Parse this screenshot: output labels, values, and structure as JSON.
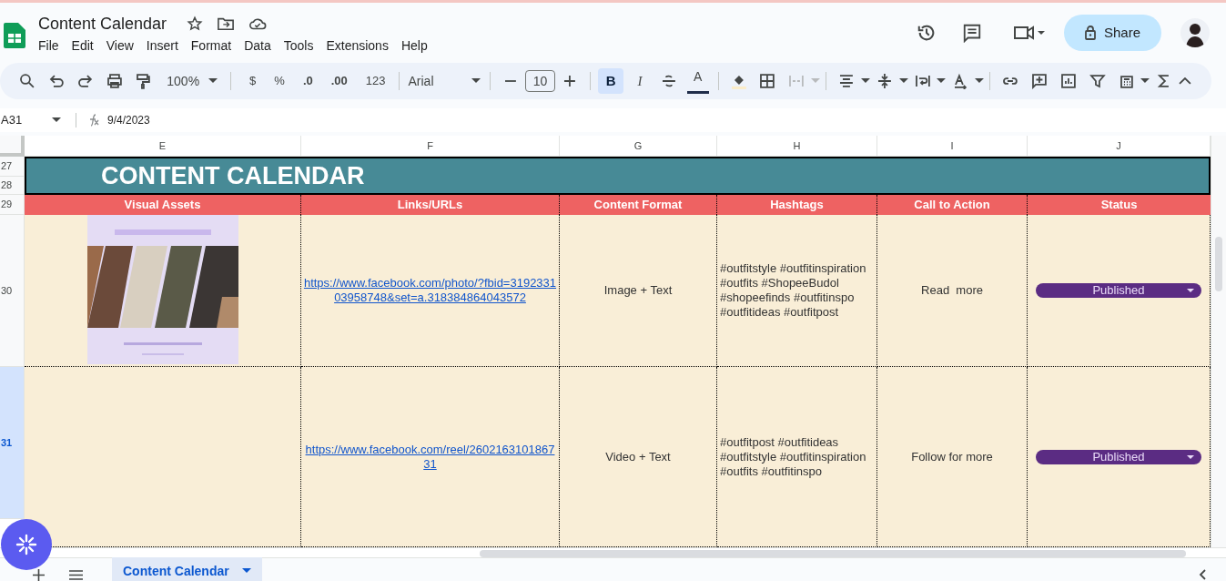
{
  "app": {
    "title": "Content Calendar",
    "menu": [
      "File",
      "Edit",
      "View",
      "Insert",
      "Format",
      "Data",
      "Tools",
      "Extensions",
      "Help"
    ]
  },
  "toolbar": {
    "zoom": "100%",
    "currency": "$",
    "percent": "%",
    "decrease_decimal": ".0",
    "increase_decimal": ".00",
    "number_format": "123",
    "font": "Arial",
    "font_size": "10",
    "text_styles": [
      {
        "label": "B",
        "selected": true
      },
      {
        "label": "I",
        "selected": false
      }
    ],
    "text_color": "A"
  },
  "share_button": "Share",
  "formula_bar": {
    "cell": "A31",
    "value": "9/4/2023"
  },
  "sheet": {
    "columns": [
      "E",
      "F",
      "G",
      "H",
      "I",
      "J"
    ],
    "title_rows": [
      "27",
      "28"
    ],
    "title": "CONTENT CALENDAR",
    "header_row_number": "29",
    "headers": [
      "Visual Assets",
      "Links/URLs",
      "Content Format",
      "Hashtags",
      "Call to Action",
      "Status"
    ],
    "rows": [
      {
        "number": "30",
        "selected": false,
        "link": "https://www.facebook.com/photo/?fbid=319233103958748&set=a.318384864043572",
        "format": "Image + Text",
        "hashtags": "#outfitstyle #outfitinspiration #outfits #ShopeeBudol #shopeefinds #outfitinspo #outfitideas #outfitpost",
        "cta": "Read  more",
        "status": "Published"
      },
      {
        "number": "31",
        "selected": true,
        "link": "https://www.facebook.com/reel/260216310186731",
        "format": "Video + Text",
        "hashtags": "#outfitpost #outfitideas #outfitstyle #outfitinspiration #outfits #outfitinspo",
        "cta": "Follow for more",
        "status": "Published"
      }
    ]
  },
  "sheet_tabs": [
    {
      "label": "Content Calendar",
      "selected": true
    }
  ]
}
